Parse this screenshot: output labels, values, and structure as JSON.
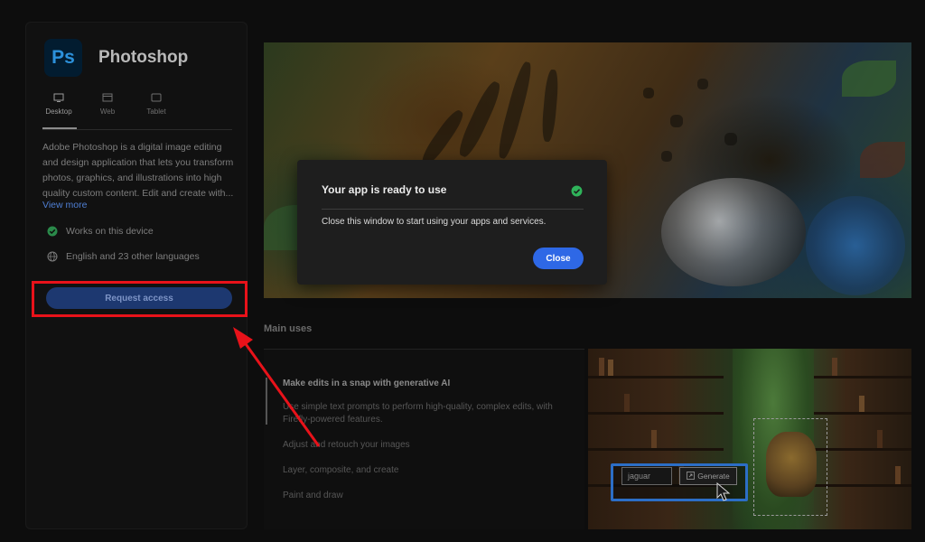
{
  "app": {
    "name": "Photoshop",
    "logo_text": "Ps"
  },
  "platforms": [
    {
      "label": "Desktop",
      "icon": "desktop-icon",
      "active": true
    },
    {
      "label": "Web",
      "icon": "web-icon",
      "active": false
    },
    {
      "label": "Tablet",
      "icon": "tablet-icon",
      "active": false
    }
  ],
  "description": "Adobe Photoshop is a digital image editing and design application that lets you transform photos, graphics, and illustrations into high quality custom content. Edit and create with...",
  "view_more": "View more",
  "features": [
    {
      "text": "Works on this device",
      "icon": "check-circle-icon"
    },
    {
      "text": "English and 23 other languages",
      "icon": "globe-icon"
    }
  ],
  "request_access": "Request access",
  "dialog": {
    "title": "Your app is ready to use",
    "body": "Close this window to start using your apps and services.",
    "close_label": "Close"
  },
  "main_uses": {
    "title": "Main uses",
    "items": [
      {
        "label": "Make edits in a snap with generative AI",
        "active": true
      },
      {
        "label": "Adjust and retouch your images",
        "active": false
      },
      {
        "label": "Layer, composite, and create",
        "active": false
      },
      {
        "label": "Paint and draw",
        "active": false
      }
    ],
    "active_description": "Use simple text prompts to perform high-quality, complex edits, with Firefly-powered features."
  },
  "demo": {
    "prompt_value": "jaguar",
    "generate_label": "Generate"
  },
  "colors": {
    "accent": "#2e68e6",
    "highlight": "#e8121a",
    "success": "#2fb35a"
  }
}
